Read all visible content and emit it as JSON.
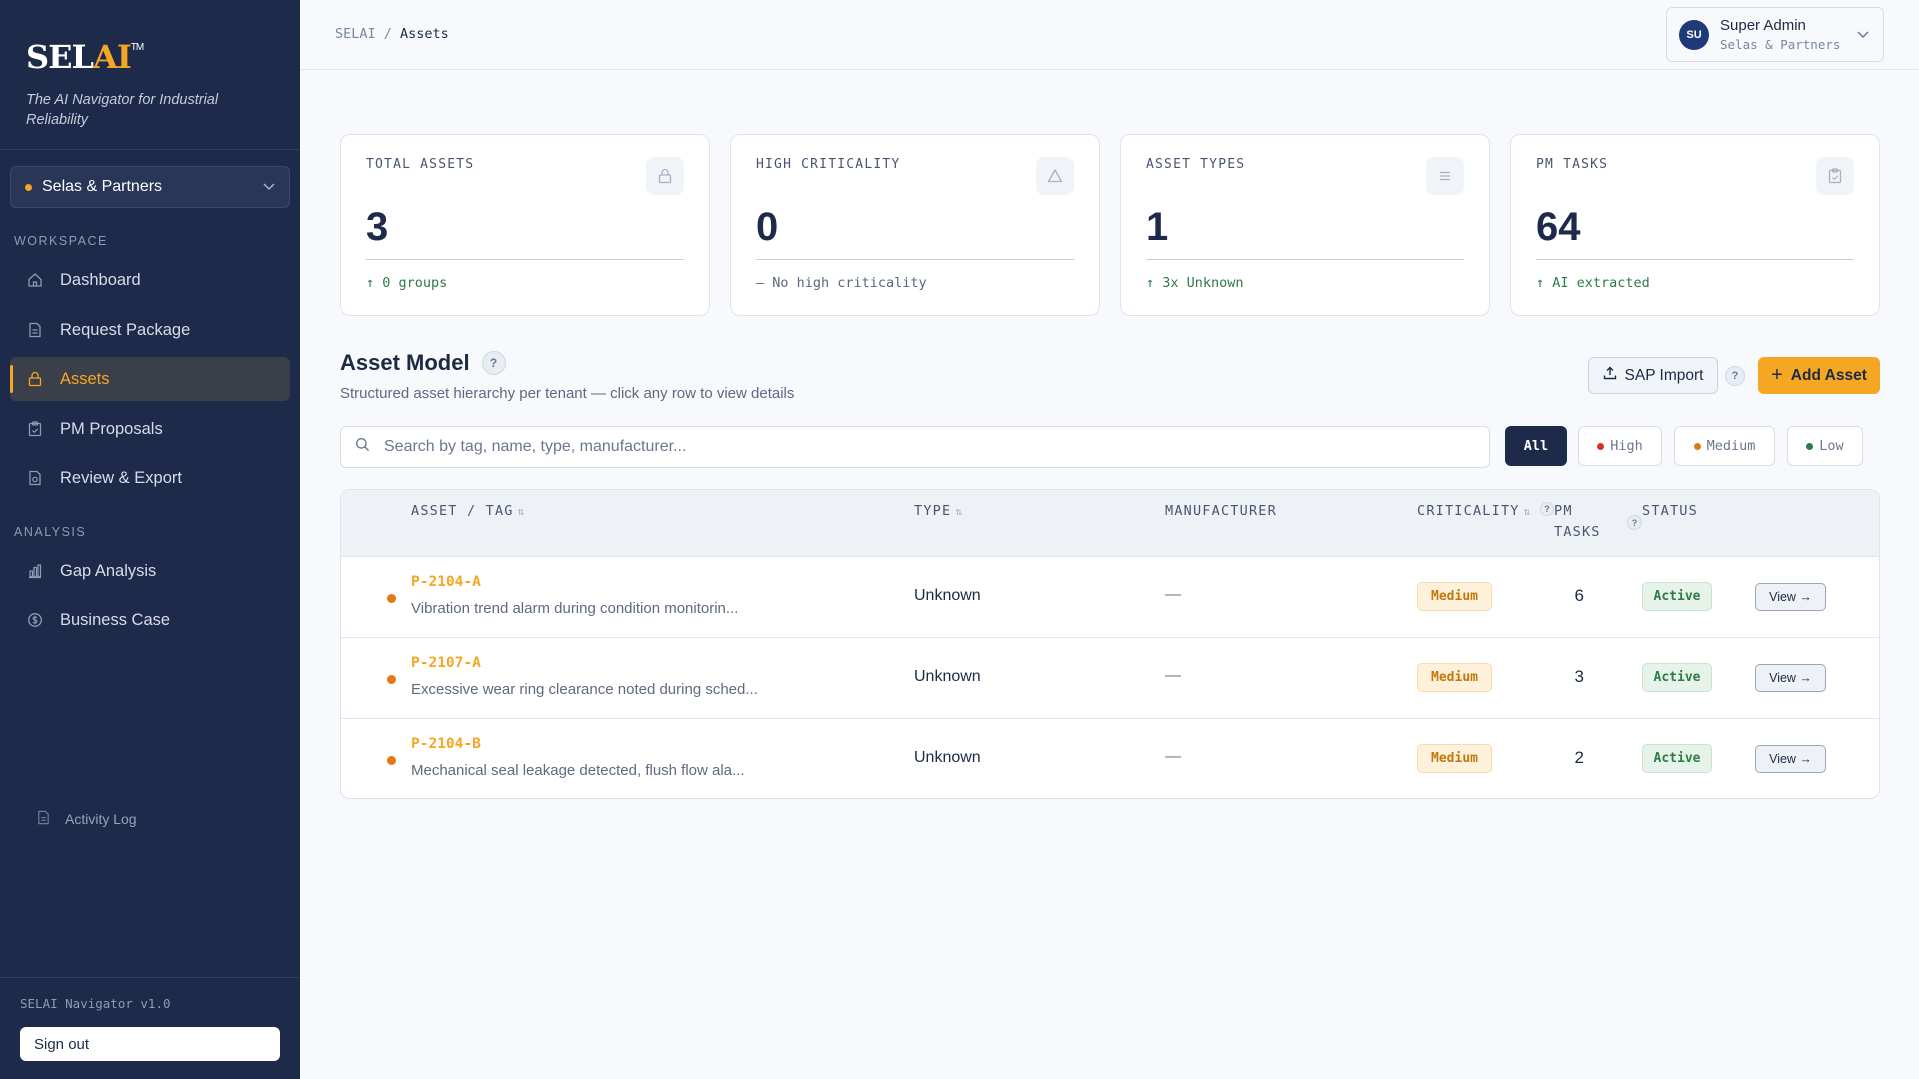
{
  "sidebar": {
    "logo_main": "SEL",
    "logo_accent": "AI",
    "logo_tm": "TM",
    "tagline": "The AI Navigator for Industrial Reliability",
    "tenant": "Selas & Partners",
    "workspace_label": "WORKSPACE",
    "workspace_items": [
      {
        "label": "Dashboard",
        "icon": "home-icon"
      },
      {
        "label": "Request Package",
        "icon": "document-icon"
      },
      {
        "label": "Assets",
        "icon": "lock-icon",
        "active": true
      },
      {
        "label": "PM Proposals",
        "icon": "clipboard-icon"
      },
      {
        "label": "Review & Export",
        "icon": "export-document-icon"
      }
    ],
    "analysis_label": "ANALYSIS",
    "analysis_items": [
      {
        "label": "Gap Analysis",
        "icon": "bar-chart-icon"
      },
      {
        "label": "Business Case",
        "icon": "dollar-circle-icon"
      }
    ],
    "activity_log": "Activity Log",
    "version": "SELAI Navigator v1.0",
    "sign_out": "Sign out"
  },
  "header": {
    "breadcrumb_root": "SELAI",
    "breadcrumb_sep": " / ",
    "breadcrumb_current": "Assets",
    "user": {
      "initials": "SU",
      "name": "Super Admin",
      "org": "Selas & Partners"
    }
  },
  "stats": [
    {
      "label": "TOTAL ASSETS",
      "value": "3",
      "foot": "↑ 0 groups",
      "icon": "lock-icon"
    },
    {
      "label": "HIGH CRITICALITY",
      "value": "0",
      "foot": "— No high criticality",
      "icon": "warning-triangle-icon"
    },
    {
      "label": "ASSET TYPES",
      "value": "1",
      "foot": "↑ 3x Unknown",
      "icon": "list-icon"
    },
    {
      "label": "PM TASKS",
      "value": "64",
      "foot": "↑ AI extracted",
      "icon": "clipboard-icon"
    }
  ],
  "asset_model": {
    "title": "Asset Model",
    "subtitle": "Structured asset hierarchy per tenant — click any row to view details",
    "sap_import": "SAP Import",
    "add_asset": "Add Asset",
    "search_placeholder": "Search by tag, name, type, manufacturer...",
    "filters": [
      {
        "label": "All",
        "active": true
      },
      {
        "label": "High",
        "color": "#d0342c"
      },
      {
        "label": "Medium",
        "color": "#e07a12"
      },
      {
        "label": "Low",
        "color": "#2f7a45"
      }
    ]
  },
  "table": {
    "columns": {
      "asset": "ASSET / TAG",
      "type": "TYPE",
      "manufacturer": "MANUFACTURER",
      "criticality": "CRITICALITY",
      "pm_tasks_1": "PM",
      "pm_tasks_2": "TASKS",
      "status": "STATUS"
    },
    "rows": [
      {
        "tag": "P-2104-A",
        "desc": "Vibration trend alarm during condition monitorin...",
        "type": "Unknown",
        "manufacturer": "—",
        "criticality": "Medium",
        "pm_tasks": "6",
        "status": "Active",
        "action": "View →"
      },
      {
        "tag": "P-2107-A",
        "desc": "Excessive wear ring clearance noted during sched...",
        "type": "Unknown",
        "manufacturer": "—",
        "criticality": "Medium",
        "pm_tasks": "3",
        "status": "Active",
        "action": "View →"
      },
      {
        "tag": "P-2104-B",
        "desc": "Mechanical seal leakage detected, flush flow ala...",
        "type": "Unknown",
        "manufacturer": "—",
        "criticality": "Medium",
        "pm_tasks": "2",
        "status": "Active",
        "action": "View →"
      }
    ]
  }
}
